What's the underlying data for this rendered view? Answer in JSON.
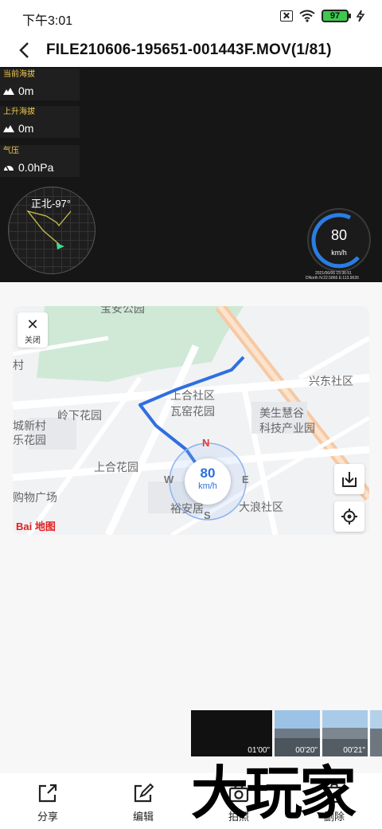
{
  "status_bar": {
    "time": "下午3:01",
    "battery": "97"
  },
  "header": {
    "title": "FILE210606-195651-001443F.MOV(1/81)"
  },
  "video": {
    "current_altitude": {
      "label": "当前海拔",
      "value": "0m"
    },
    "ascent": {
      "label": "上升海拔",
      "value": "0m"
    },
    "pressure": {
      "label": "气压",
      "value": "0.0hPa"
    },
    "heading": "正北-97°",
    "speed": "80",
    "speed_unit": "km/h",
    "overlay_line1": "2021/06/06 15:36:51",
    "overlay_line2": "DNorth N:22.5866  E:113.9026"
  },
  "map": {
    "close_label": "关闭",
    "speed": "80",
    "speed_unit": "km/h",
    "dirs": {
      "n": "N",
      "e": "E",
      "s": "S",
      "w": "W"
    },
    "places": [
      "宝安公园",
      "上合社区",
      "瓦窑花园",
      "美生慧谷",
      "科技产业园",
      "兴东社区",
      "岭下花园",
      "上合花园",
      "城新村",
      "乐花园",
      "购物广场",
      "裕安居",
      "大浪社区",
      "村"
    ],
    "logo": "Bai 地图"
  },
  "thumbnails": [
    {
      "time": "01'00\""
    },
    {
      "time": "00'20\""
    },
    {
      "time": "00'21\""
    }
  ],
  "toolbar": {
    "share": "分享",
    "edit": "编辑",
    "photo": "拍照",
    "delete": "删除"
  },
  "watermark": "大玩家",
  "colors": {
    "accent": "#2a6fdb",
    "route": "#3174e6",
    "battery": "#3ec94e"
  }
}
